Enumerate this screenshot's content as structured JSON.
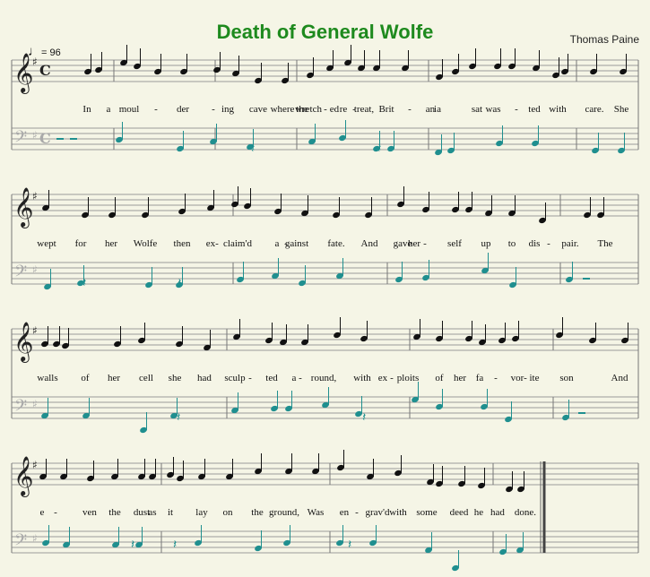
{
  "title": "Death of General Wolfe",
  "composer": "Thomas Paine",
  "tempo": {
    "note_icon": "quarter-note-icon",
    "value": "= 96"
  },
  "colors": {
    "background": "#f5f5e6",
    "title": "#1e8a1e",
    "bass_notes": "#1f8f8f",
    "notes": "#111111",
    "staff_lines": "#9a9a9a"
  },
  "lyrics": [
    [
      "In",
      "a",
      "moul",
      "-",
      "der",
      "-",
      "ing",
      "cave",
      "where",
      "the",
      "wretch",
      "-",
      "ed",
      "re",
      "-",
      "treat,",
      "Brit",
      "-",
      "an",
      "ia",
      "sat",
      "was",
      "-",
      "ted",
      "with",
      "care.",
      "She"
    ],
    [
      "wept",
      "for",
      "her",
      "Wolfe",
      "then",
      "ex",
      "-",
      "claim'd",
      "a",
      "-",
      "gainst",
      "fate.",
      "And",
      "gave",
      "her",
      "-",
      "self",
      "up",
      "to",
      "dis",
      "-",
      "pair.",
      "The"
    ],
    [
      "walls",
      "of",
      "her",
      "cell",
      "she",
      "had",
      "sculp",
      "-",
      "ted",
      "a",
      "-",
      "round,",
      "with",
      "ex",
      "-",
      "ploits",
      "of",
      "her",
      "fa",
      "-",
      "vor",
      "-",
      "ite",
      "son",
      "And"
    ],
    [
      "e",
      "-",
      "ven",
      "the",
      "dust",
      "as",
      "it",
      "lay",
      "on",
      "the",
      "ground,",
      "Was",
      "en",
      "-",
      "grav'd",
      "with",
      "some",
      "deed",
      "he",
      "had",
      "done."
    ]
  ]
}
